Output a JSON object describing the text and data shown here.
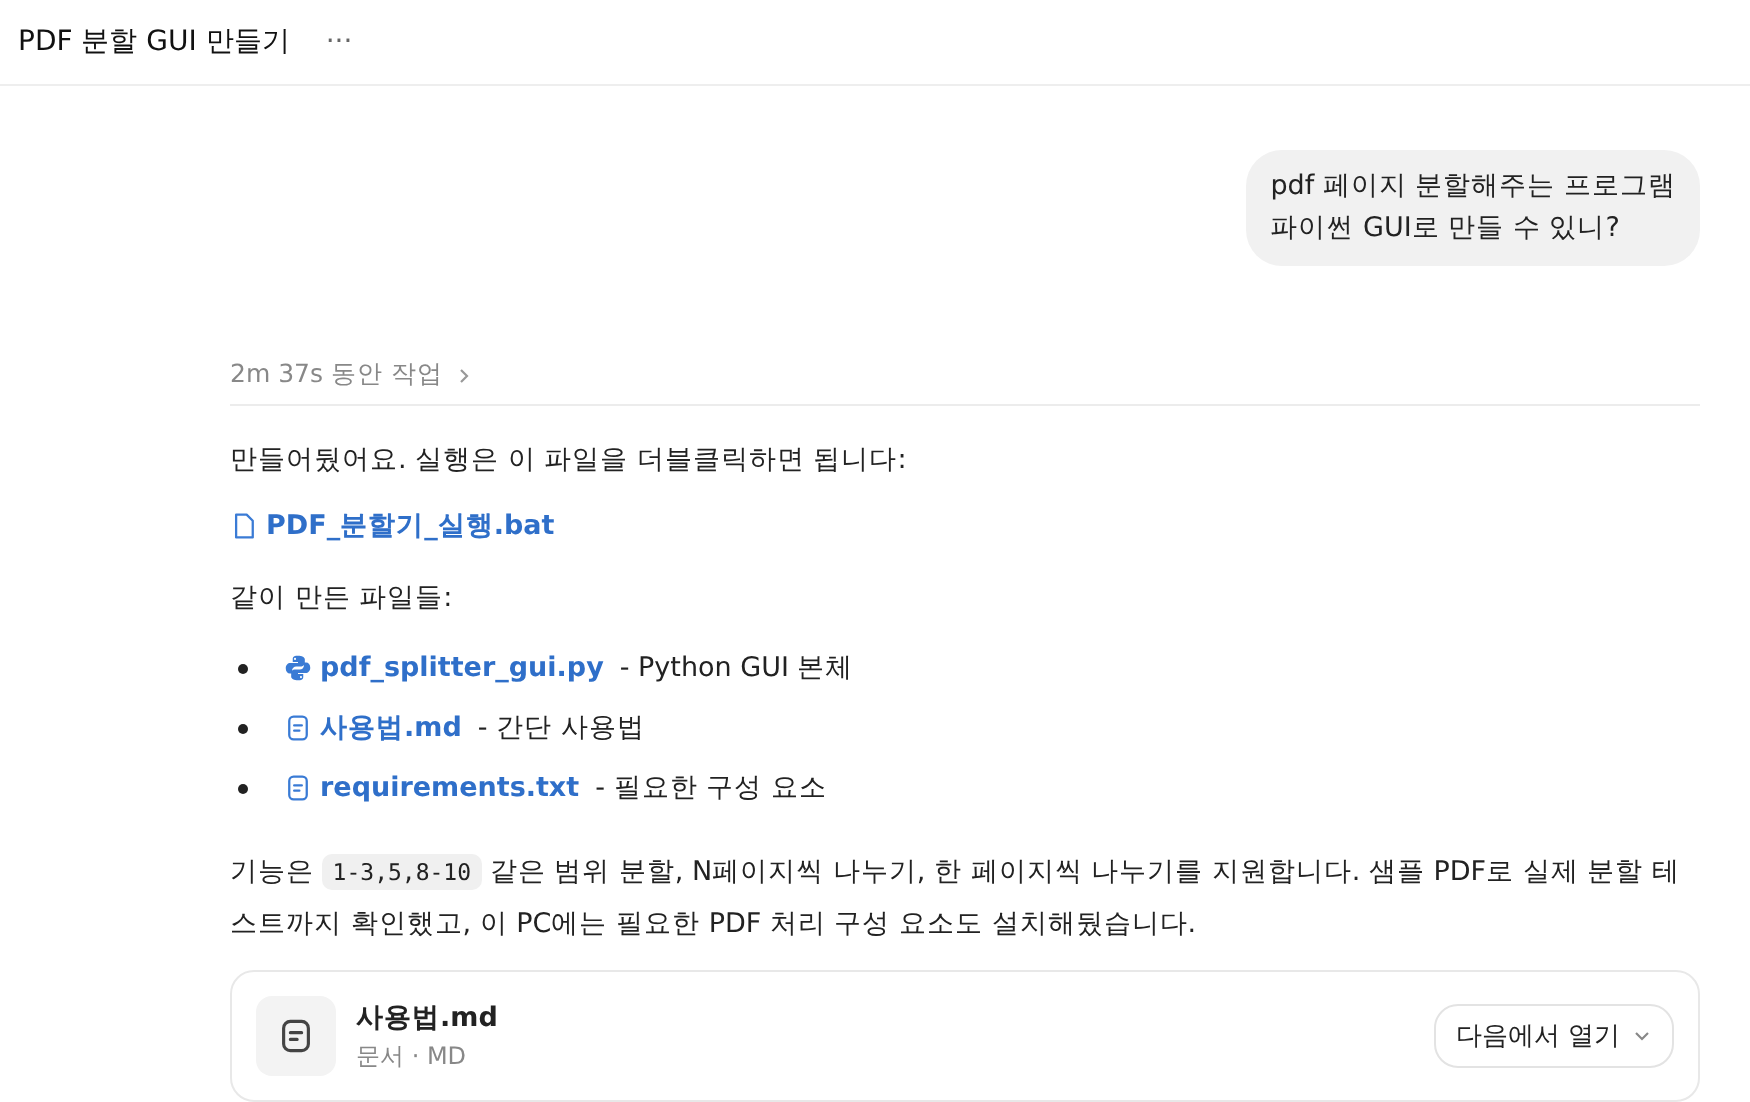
{
  "header": {
    "title": "PDF 분할 GUI 만들기",
    "more": "···"
  },
  "user_message": {
    "lines": [
      "pdf 페이지 분할해주는 프로그램",
      "파이썬 GUI로 만들 수 있니?"
    ]
  },
  "work_summary": {
    "label": "2m 37s 동안 작업",
    "expanded": false
  },
  "intro": "만들어뒀어요. 실행은 이 파일을 더블클릭하면 됩니다:",
  "main_file": {
    "name": "PDF_분할기_실행.bat",
    "kind": "file"
  },
  "files_heading": "같이 만든 파일들:",
  "files": [
    {
      "name": "pdf_splitter_gui.py",
      "kind": "python",
      "description": "- Python GUI 본체"
    },
    {
      "name": "사용법.md",
      "kind": "doc",
      "description": "- 간단 사용법"
    },
    {
      "name": "requirements.txt",
      "kind": "doc",
      "description": "- 필요한 구성 요소"
    }
  ],
  "feature": {
    "before": "기능은",
    "code": "1-3,5,8-10",
    "after": "같은 범위 분할, N페이지씩 나누기, 한 페이지씩 나누기를 지원합니다. 샘플 PDF로 실제 분할 테스트까지 확인했고, 이 PC에는 필요한 PDF 처리 구성 요소도 설치해뒀습니다."
  },
  "attachment": {
    "name": "사용법.md",
    "meta": "문서 · MD",
    "action": "다음에서 열기"
  }
}
